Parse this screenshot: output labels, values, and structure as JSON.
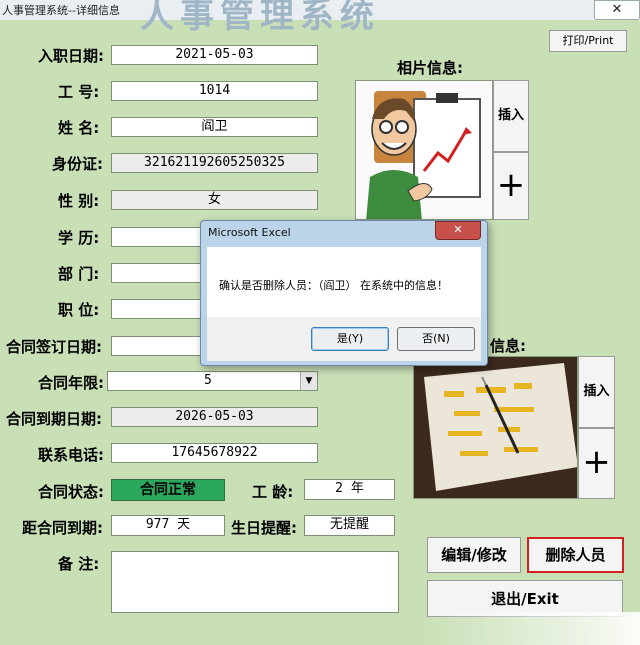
{
  "window": {
    "title": "人事管理系统--详细信息",
    "watermark": "人事管理系统",
    "close_label": "✕"
  },
  "print_button": "打印/Print",
  "photo_section": {
    "label": "相片信息:",
    "insert_label": "插入",
    "add_label": "+"
  },
  "second_section": {
    "label": "信息:",
    "insert_label": "插入",
    "add_label": "+"
  },
  "fields": {
    "hire_date": {
      "label": "入职日期:",
      "value": "2021-05-03"
    },
    "employee_no": {
      "label": "工  号:",
      "value": "1014"
    },
    "name": {
      "label": "姓  名:",
      "value": "阎卫"
    },
    "id_card": {
      "label": "身份证:",
      "value": "321621192605250325"
    },
    "gender": {
      "label": "性  别:",
      "value": "女"
    },
    "education": {
      "label": "学  历:",
      "value": "研"
    },
    "department": {
      "label": "部  门:",
      "value": "生"
    },
    "position": {
      "label": "职  位:",
      "value": "工"
    },
    "contract_sign_date": {
      "label": "合同签订日期:",
      "value": "202"
    },
    "contract_years": {
      "label": "合同年限:",
      "value": "5"
    },
    "contract_end_date": {
      "label": "合同到期日期:",
      "value": "2026-05-03"
    },
    "phone": {
      "label": "联系电话:",
      "value": "17645678922"
    },
    "contract_status": {
      "label": "合同状态:",
      "value": "合同正常"
    },
    "seniority": {
      "label": "工  龄:",
      "value": "2 年"
    },
    "days_to_expiry": {
      "label": "距合同到期:",
      "value": "977 天"
    },
    "birthday_reminder": {
      "label": "生日提醒:",
      "value": "无提醒"
    },
    "remarks": {
      "label": "备  注:",
      "value": ""
    }
  },
  "buttons": {
    "edit": "编辑/修改",
    "delete": "删除人员",
    "exit": "退出/Exit"
  },
  "dialog": {
    "title": "Microsoft Excel",
    "message": "确认是否删除人员：（阎卫） 在系统中的信息！",
    "yes": "是(Y)",
    "no": "否(N)"
  },
  "colors": {
    "background": "#c9dfb6",
    "status_ok": "#2ca85e",
    "delete_border": "#d21f1f"
  }
}
